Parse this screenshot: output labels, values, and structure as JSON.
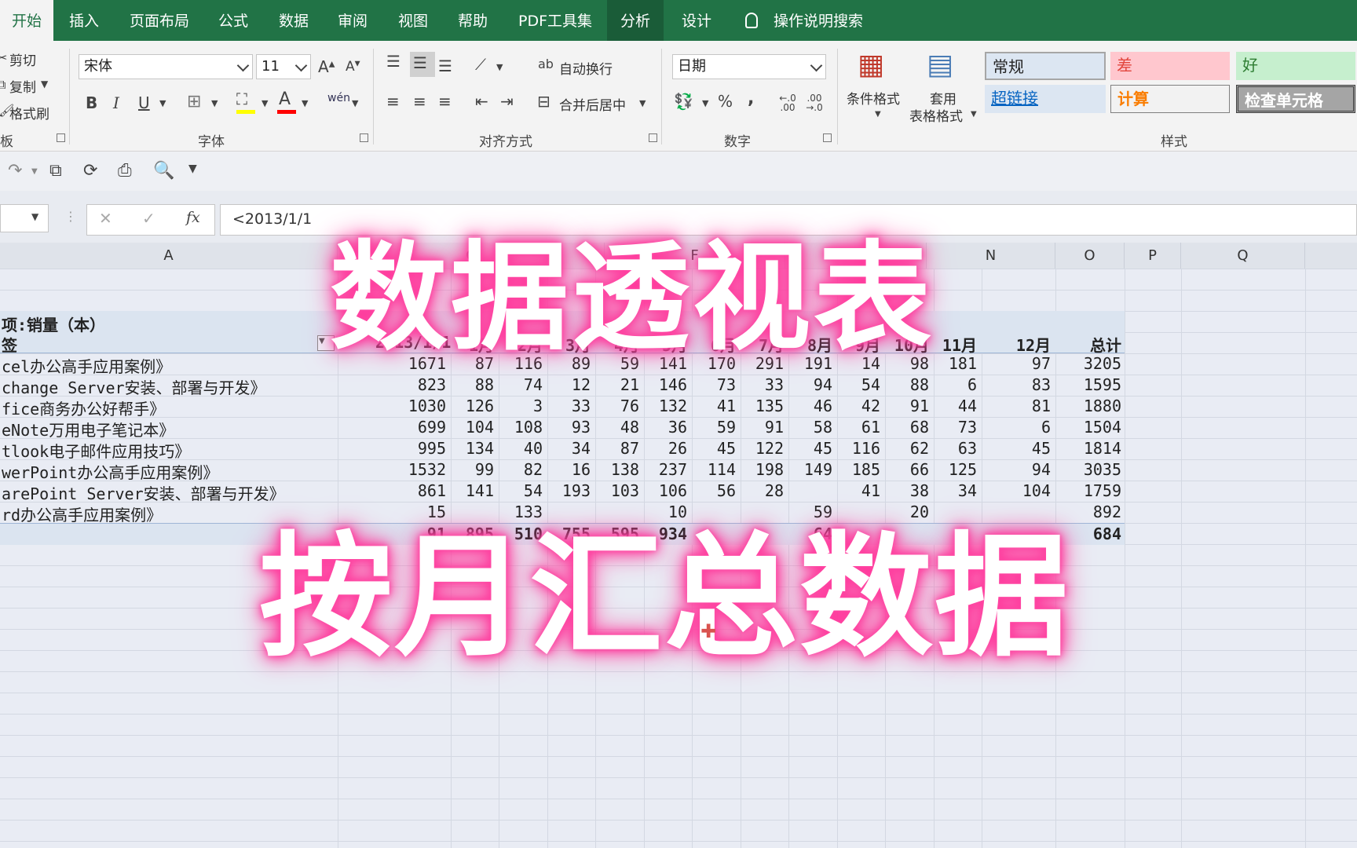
{
  "ribbon_tabs": [
    {
      "label": "开始",
      "active": true
    },
    {
      "label": "插入"
    },
    {
      "label": "页面布局"
    },
    {
      "label": "公式"
    },
    {
      "label": "数据"
    },
    {
      "label": "审阅"
    },
    {
      "label": "视图"
    },
    {
      "label": "帮助"
    },
    {
      "label": "PDF工具集"
    },
    {
      "label": "分析"
    },
    {
      "label": "设计"
    }
  ],
  "tell_me": "操作说明搜索",
  "clipboard": {
    "cut": "剪切",
    "copy": "复制",
    "format_painter": "格式刷",
    "group_label": "板"
  },
  "font": {
    "name": "宋体",
    "size": "11",
    "group_label": "字体",
    "grow": "A",
    "shrink": "A",
    "bold": "B",
    "italic": "I",
    "underline": "U",
    "phonetic": "wén"
  },
  "alignment": {
    "wrap": "自动换行",
    "merge": "合并后居中",
    "group_label": "对齐方式"
  },
  "number": {
    "format": "日期",
    "percent": "%",
    "comma": ",",
    "inc": "←.0 .00",
    "dec": ".00 →.0",
    "group_label": "数字"
  },
  "styles": {
    "conditional": "条件格式",
    "table_format_1": "套用",
    "table_format_2": "表格格式",
    "group_label": "样式",
    "cells": [
      {
        "label": "常规",
        "bg": "#dce6f2",
        "color": "#222222",
        "border": "#a6a6a6"
      },
      {
        "label": "差",
        "bg": "#ffc7ce",
        "color": "#9c0006",
        "border": "#ffc7ce"
      },
      {
        "label": "好",
        "bg": "#c6efce",
        "color": "#006100",
        "border": "#c6efce"
      },
      {
        "label": "超链接",
        "bg": "#dce6f2",
        "color": "#0563c1",
        "border": "#dce6f2"
      },
      {
        "label": "计算",
        "bg": "#f2f2f2",
        "color": "#fa7d00",
        "border": "#7f7f7f"
      },
      {
        "label": "检查单元格",
        "bg": "#a5a5a5",
        "color": "#ffffff",
        "border": "#3f3f3f"
      }
    ]
  },
  "formula_bar": {
    "fx": "fx",
    "value": "<2013/1/1"
  },
  "columns": [
    "A",
    "C",
    "F",
    "I",
    "N",
    "O",
    "P",
    "Q"
  ],
  "pivot": {
    "value_label": "项:销量（本）",
    "row_label": "签",
    "headers": [
      "2013/1/1",
      "1月",
      "2月",
      "3月",
      "4月",
      "5月",
      "6月",
      "7月",
      "8月",
      "9月",
      "10月",
      "11月",
      "12月",
      "总计"
    ],
    "rows": [
      {
        "name": "cel办公高手应用案例》",
        "values": [
          "1671",
          "87",
          "116",
          "89",
          "59",
          "141",
          "170",
          "291",
          "191",
          "14",
          "98",
          "181",
          "97",
          "3205"
        ]
      },
      {
        "name": "change Server安装、部署与开发》",
        "values": [
          "823",
          "88",
          "74",
          "12",
          "21",
          "146",
          "73",
          "33",
          "94",
          "54",
          "88",
          "6",
          "83",
          "1595"
        ]
      },
      {
        "name": "fice商务办公好帮手》",
        "values": [
          "1030",
          "126",
          "3",
          "33",
          "76",
          "132",
          "41",
          "135",
          "46",
          "42",
          "91",
          "44",
          "81",
          "1880"
        ]
      },
      {
        "name": "eNote万用电子笔记本》",
        "values": [
          "699",
          "104",
          "108",
          "93",
          "48",
          "36",
          "59",
          "91",
          "58",
          "61",
          "68",
          "73",
          "6",
          "1504"
        ]
      },
      {
        "name": "tlook电子邮件应用技巧》",
        "values": [
          "995",
          "134",
          "40",
          "34",
          "87",
          "26",
          "45",
          "122",
          "45",
          "116",
          "62",
          "63",
          "45",
          "1814"
        ]
      },
      {
        "name": "werPoint办公高手应用案例》",
        "values": [
          "1532",
          "99",
          "82",
          "16",
          "138",
          "237",
          "114",
          "198",
          "149",
          "185",
          "66",
          "125",
          "94",
          "3035"
        ]
      },
      {
        "name": "arePoint Server安装、部署与开发》",
        "values": [
          "861",
          "141",
          "54",
          "193",
          "103",
          "106",
          "56",
          "28",
          "",
          "41",
          "38",
          "34",
          "104",
          "1759"
        ]
      },
      {
        "name": "rd办公高手应用案例》",
        "values": [
          "15",
          "",
          "133",
          "",
          "",
          "10",
          "",
          "",
          "59",
          "",
          "20",
          "",
          "",
          "892"
        ]
      }
    ],
    "total_values": [
      "91",
      "895",
      "510",
      "755",
      "595",
      "934",
      "",
      "",
      "64",
      "",
      "",
      "",
      "",
      "684"
    ]
  },
  "overlay": {
    "line1": "数据透视表",
    "line2": "按月汇总数据"
  }
}
